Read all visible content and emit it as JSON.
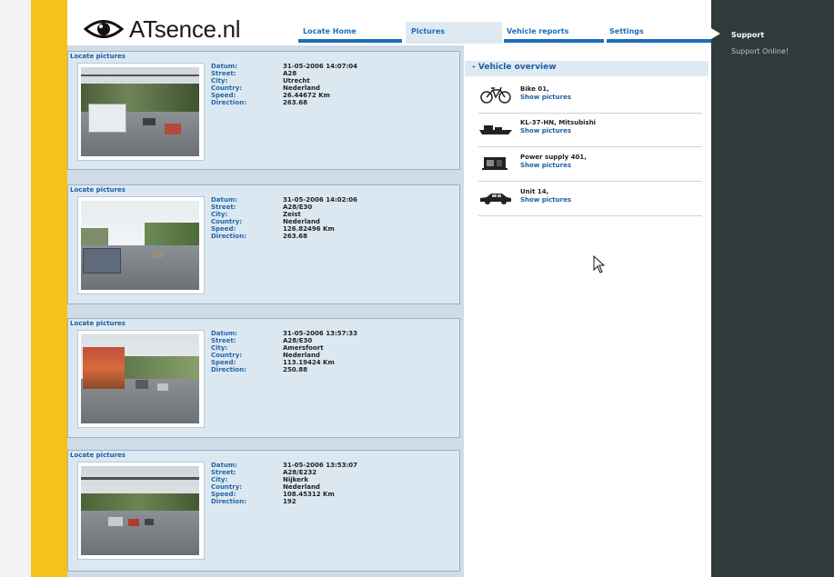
{
  "brand": {
    "logo_text": "ATsence.nl"
  },
  "nav": {
    "tabs": [
      {
        "label": "Locate Home"
      },
      {
        "label": "Pictures"
      },
      {
        "label": "Vehicle reports"
      },
      {
        "label": "Settings"
      }
    ]
  },
  "sidebar": {
    "support_label": "Support",
    "support_online_label": "Support Online!"
  },
  "pictures": {
    "field_labels": [
      "Datum:",
      "Street:",
      "City:",
      "Country:",
      "Speed:",
      "Direction:"
    ],
    "cards": [
      {
        "title": "Locate pictures",
        "datum": "31-05-2006 14:07:04",
        "street": "A28",
        "city": "Utrecht",
        "country": "Nederland",
        "speed": "26.44672 Km",
        "direction": "263.68"
      },
      {
        "title": "Locate pictures",
        "datum": "31-05-2006 14:02:06",
        "street": "A28/E30",
        "city": "Zeist",
        "country": "Nederland",
        "speed": "126.82496 Km",
        "direction": "263.68"
      },
      {
        "title": "Locate pictures",
        "datum": "31-05-2006 13:57:33",
        "street": "A28/E30",
        "city": "Amersfoort",
        "country": "Nederland",
        "speed": "113.19424 Km",
        "direction": "250.88"
      },
      {
        "title": "Locate pictures",
        "datum": "31-05-2006 13:53:07",
        "street": "A28/E232",
        "city": "Nijkerk",
        "country": "Nederland",
        "speed": "108.45312 Km",
        "direction": "192"
      }
    ]
  },
  "vehicle_overview": {
    "title": "- Vehicle overview",
    "items": [
      {
        "name": "Bike 01,",
        "link": "Show pictures",
        "icon": "bicycle-icon"
      },
      {
        "name": "KL-37-HN, Mitsubishi",
        "link": "Show pictures",
        "icon": "boat-icon"
      },
      {
        "name": "Power supply 401,",
        "link": "Show pictures",
        "icon": "generator-icon"
      },
      {
        "name": "Unit 14,",
        "link": "Show pictures",
        "icon": "car-icon"
      }
    ]
  },
  "colors": {
    "accent": "#1d6db8",
    "sidebar_yellow": "#f5c21b",
    "right_panel": "#2f3b3a",
    "card_bg": "#dce8f1"
  }
}
